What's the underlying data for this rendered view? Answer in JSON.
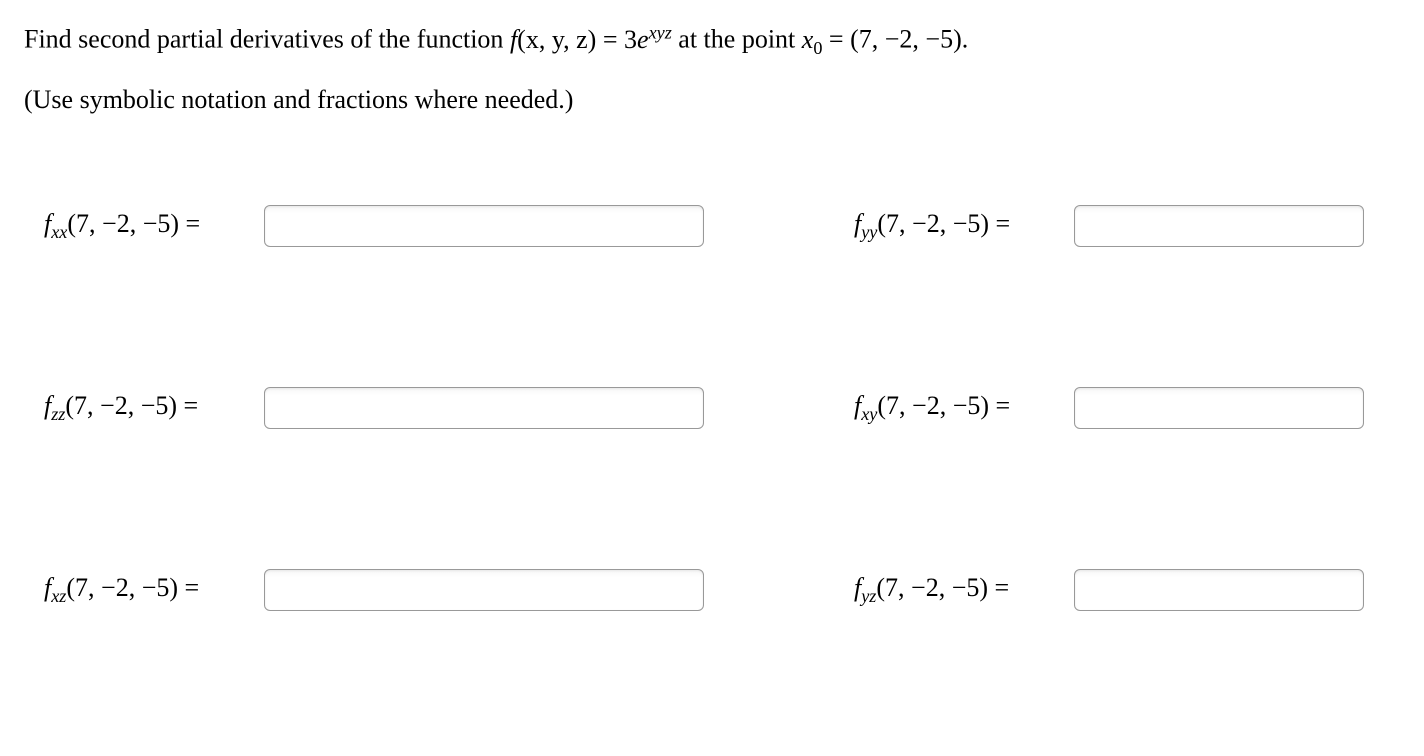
{
  "problem": {
    "prefix": "Find second partial derivatives of the function ",
    "func_name": "f",
    "func_args": "(x, y, z)",
    "equals": " = 3",
    "e_base": "e",
    "exponent": "xyz",
    "mid": " at the point ",
    "point_var": "x",
    "point_sub": "0",
    "point_eq": " = (7, −2, −5).",
    "instructions": "(Use symbolic notation and fractions where needed.)"
  },
  "answers": [
    {
      "sub": "xx",
      "point": "(7, −2, −5) =",
      "col": "left"
    },
    {
      "sub": "yy",
      "point": "(7, −2, −5) =",
      "col": "right"
    },
    {
      "sub": "zz",
      "point": "(7, −2, −5) =",
      "col": "left"
    },
    {
      "sub": "xy",
      "point": "(7, −2, −5) =",
      "col": "right"
    },
    {
      "sub": "xz",
      "point": "(7, −2, −5) =",
      "col": "left"
    },
    {
      "sub": "yz",
      "point": "(7, −2, −5) =",
      "col": "right"
    }
  ]
}
